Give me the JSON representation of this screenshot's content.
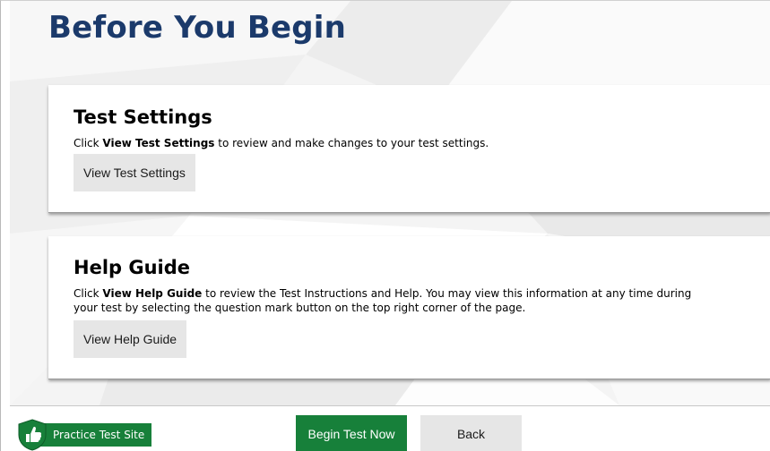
{
  "page": {
    "title": "Before You Begin"
  },
  "test_settings": {
    "heading": "Test Settings",
    "text_prefix": "Click ",
    "text_bold": "View Test Settings",
    "text_suffix": " to review and make changes to your test settings.",
    "button_label": "View Test Settings"
  },
  "help_guide": {
    "heading": "Help Guide",
    "text_prefix": "Click ",
    "text_bold": "View Help Guide",
    "text_suffix": " to review the Test Instructions and Help. You may view this information at any time during your test by selecting the question mark button on the top right corner of the page.",
    "button_label": "View Help Guide"
  },
  "footer": {
    "site_badge_label": "Practice Test Site",
    "site_badge_icon": "shield-thumbs-up-icon",
    "begin_button_label": "Begin Test Now",
    "back_button_label": "Back"
  },
  "colors": {
    "title": "#1b3a6b",
    "primary_green": "#17803a",
    "secondary_button": "#e6e6e6",
    "background": "#f4f4f4"
  }
}
